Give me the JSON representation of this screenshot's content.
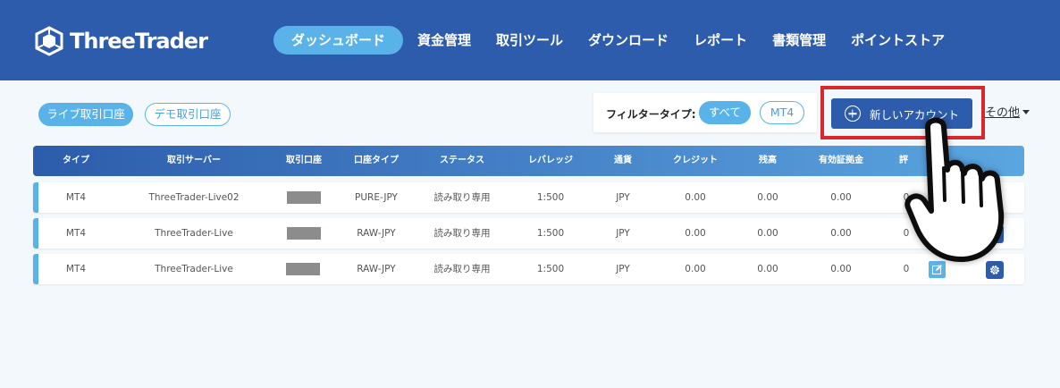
{
  "header": {
    "brand": "ThreeTrader",
    "nav": [
      {
        "label": "ダッシュボード",
        "active": true
      },
      {
        "label": "資金管理"
      },
      {
        "label": "取引ツール"
      },
      {
        "label": "ダウンロード"
      },
      {
        "label": "レポート"
      },
      {
        "label": "書類管理"
      },
      {
        "label": "ポイントストア"
      }
    ]
  },
  "toolbar": {
    "account_tabs": [
      "ライブ取引口座",
      "デモ取引口座"
    ],
    "filter_label": "フィルタータイプ:",
    "filter_options": [
      "すべて",
      "MT4"
    ],
    "new_account_label": "新しいアカウント",
    "other_label": "その他"
  },
  "table": {
    "columns": [
      "タイプ",
      "取引サーバー",
      "取引口座",
      "口座タイプ",
      "ステータス",
      "レバレッジ",
      "通貨",
      "クレジット",
      "残高",
      "有効証拠金",
      "評"
    ],
    "rows": [
      {
        "type": "MT4",
        "server": "ThreeTrader-Live02",
        "account_type": "PURE-JPY",
        "status": "読み取り専用",
        "leverage": "1:500",
        "currency": "JPY",
        "credit": "0.00",
        "balance": "0.00",
        "equity": "0.00",
        "eval": "0"
      },
      {
        "type": "MT4",
        "server": "ThreeTrader-Live",
        "account_type": "RAW-JPY",
        "status": "読み取り専用",
        "leverage": "1:500",
        "currency": "JPY",
        "credit": "0.00",
        "balance": "0.00",
        "equity": "0.00",
        "eval": "0"
      },
      {
        "type": "MT4",
        "server": "ThreeTrader-Live",
        "account_type": "RAW-JPY",
        "status": "読み取り専用",
        "leverage": "1:500",
        "currency": "JPY",
        "credit": "0.00",
        "balance": "0.00",
        "equity": "0.00",
        "eval": "0"
      }
    ]
  },
  "colors": {
    "header_bg": "#2c5cab",
    "accent": "#5ab3e8",
    "highlight_frame": "#d8282e"
  },
  "icons": {
    "new_account": "plus-circle-icon",
    "row_edit": "edit-icon",
    "row_settings": "gear-icon",
    "cursor": "pointing-hand-icon"
  }
}
